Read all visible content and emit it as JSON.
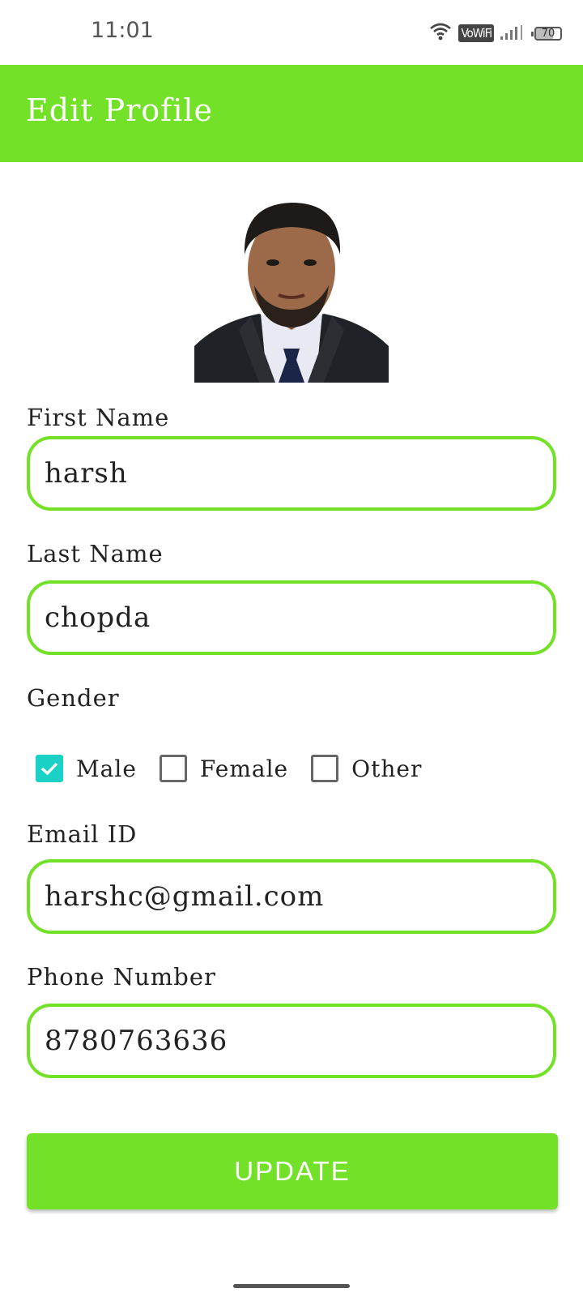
{
  "status_bar": {
    "time": "11:01",
    "vowifi_label": "VoWiFi",
    "battery_level": "70"
  },
  "app_bar": {
    "title": "Edit Profile",
    "color": "#72e127"
  },
  "form": {
    "first_name": {
      "label": "First Name",
      "value": "harsh"
    },
    "last_name": {
      "label": "Last Name",
      "value": "chopda"
    },
    "gender": {
      "label": "Gender",
      "options": [
        {
          "label": "Male",
          "checked": true
        },
        {
          "label": "Female",
          "checked": false
        },
        {
          "label": "Other",
          "checked": false
        }
      ]
    },
    "email": {
      "label": "Email ID",
      "value": "harshc@gmail.com"
    },
    "phone": {
      "label": "Phone Number",
      "value": "8780763636"
    },
    "submit_label": "UPDATE"
  },
  "colors": {
    "accent": "#72e127",
    "checkbox_checked": "#19d1c4"
  }
}
